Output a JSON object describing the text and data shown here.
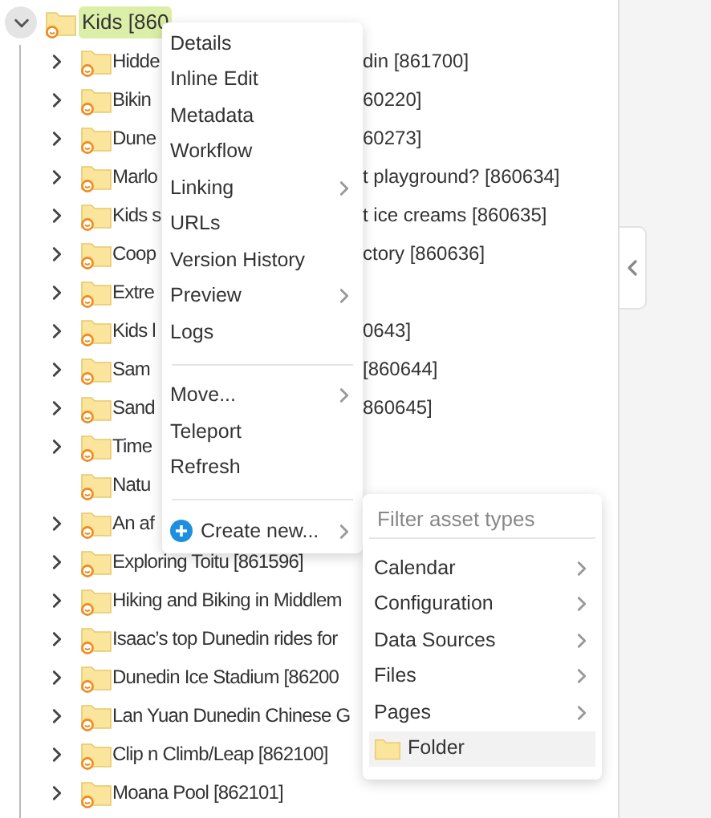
{
  "tree": {
    "root": {
      "label": "Kids [860",
      "expanded": true,
      "selected": true
    },
    "children": [
      {
        "name": "Hidde",
        "tail": "din [861700]",
        "expandable": true
      },
      {
        "name": "Bikin",
        "tail": "60220]",
        "expandable": true
      },
      {
        "name": "Dune",
        "tail": "60273]",
        "expandable": true
      },
      {
        "name": "Marlo",
        "tail": "t playground? [860634]",
        "expandable": true
      },
      {
        "name": "Kids s",
        "tail": "t ice creams [860635]",
        "expandable": true
      },
      {
        "name": "Coop",
        "tail": "ctory [860636]",
        "expandable": true
      },
      {
        "name": "Extre",
        "expandable": true
      },
      {
        "name": "Kids l",
        "tail": "0643]",
        "expandable": true
      },
      {
        "name": "Sam",
        "tail": "[860644]",
        "expandable": true
      },
      {
        "name": "Sand",
        "tail": "860645]",
        "expandable": true
      },
      {
        "name": "Time",
        "expandable": true
      },
      {
        "name": "Natu",
        "expandable": false
      },
      {
        "name": "An af",
        "expandable": true
      },
      {
        "name": "Exploring Toitu [861596]",
        "expandable": true
      },
      {
        "name": "Hiking and Biking in Middlem",
        "expandable": true
      },
      {
        "name": "Isaac’s top Dunedin rides for",
        "expandable": true
      },
      {
        "name": "Dunedin Ice Stadium [86200",
        "expandable": true
      },
      {
        "name": "Lan Yuan Dunedin Chinese G",
        "expandable": true
      },
      {
        "name": "Clip n Climb/Leap [862100]",
        "expandable": true
      },
      {
        "name": "Moana Pool [862101]",
        "expandable": true
      }
    ]
  },
  "context_menu": {
    "items": [
      {
        "kind": "item",
        "label": "Details",
        "has_submenu": false
      },
      {
        "kind": "item",
        "label": "Inline Edit",
        "has_submenu": false
      },
      {
        "kind": "item",
        "label": "Metadata",
        "has_submenu": false
      },
      {
        "kind": "item",
        "label": "Workflow",
        "has_submenu": false
      },
      {
        "kind": "item",
        "label": "Linking",
        "has_submenu": true
      },
      {
        "kind": "item",
        "label": "URLs",
        "has_submenu": false
      },
      {
        "kind": "item",
        "label": "Version History",
        "has_submenu": false
      },
      {
        "kind": "item",
        "label": "Preview",
        "has_submenu": true
      },
      {
        "kind": "item",
        "label": "Logs",
        "has_submenu": false
      },
      {
        "kind": "divider"
      },
      {
        "kind": "item",
        "label": "Move...",
        "has_submenu": true
      },
      {
        "kind": "item",
        "label": "Teleport",
        "has_submenu": false
      },
      {
        "kind": "item",
        "label": "Refresh",
        "has_submenu": false
      },
      {
        "kind": "divider"
      },
      {
        "kind": "create",
        "label": "Create new...",
        "has_submenu": true
      }
    ]
  },
  "create_submenu": {
    "placeholder": "Filter asset types",
    "items": [
      {
        "kind": "category",
        "label": "Calendar",
        "selected": false
      },
      {
        "kind": "category",
        "label": "Configuration",
        "selected": false
      },
      {
        "kind": "category",
        "label": "Data Sources",
        "selected": false
      },
      {
        "kind": "category",
        "label": "Files",
        "selected": false
      },
      {
        "kind": "category",
        "label": "Pages",
        "selected": false
      },
      {
        "kind": "asset",
        "label": "Folder",
        "selected": true
      }
    ]
  }
}
